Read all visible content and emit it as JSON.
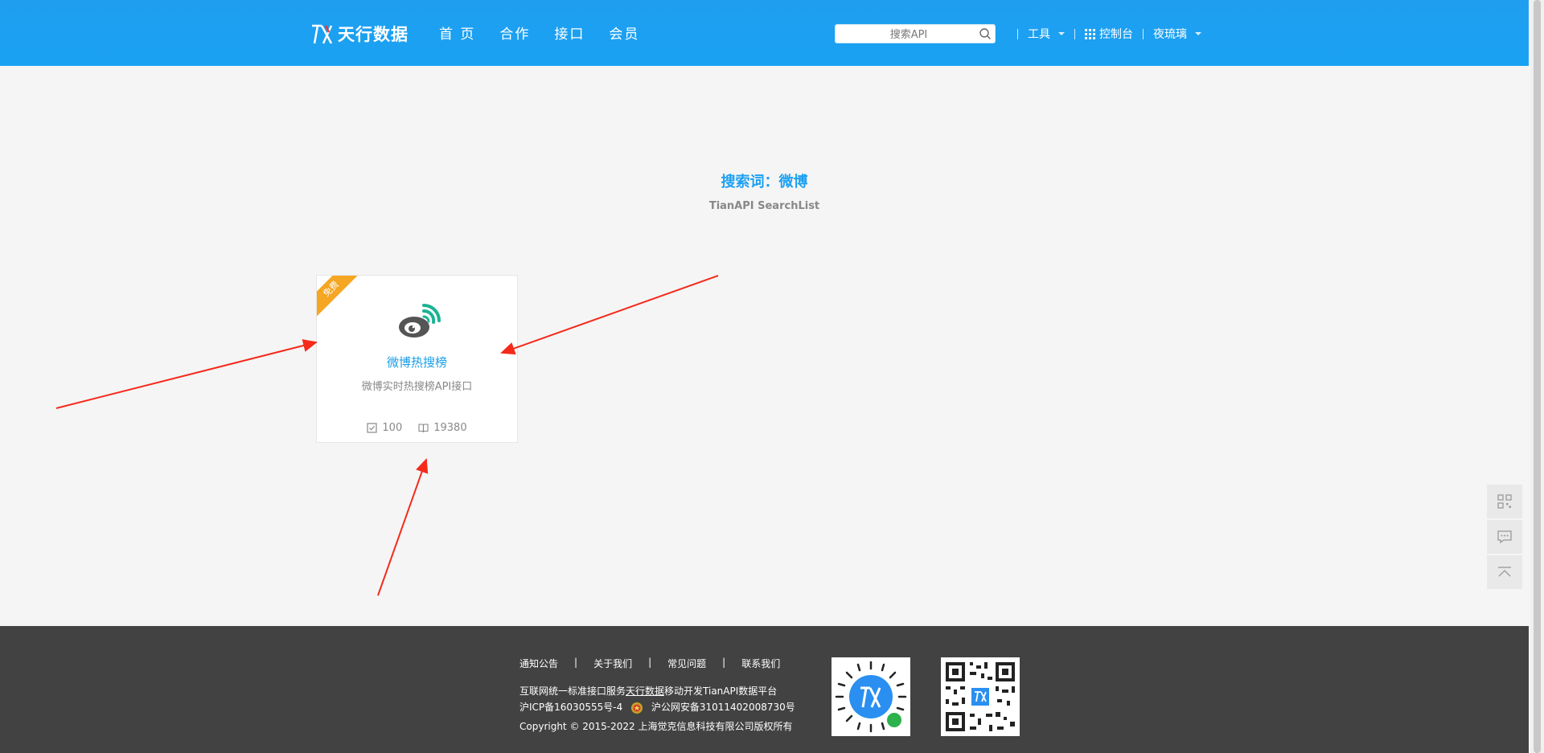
{
  "header": {
    "logo_text": "天行数据",
    "nav": [
      "首 页",
      "合作",
      "接口",
      "会员"
    ],
    "search_placeholder": "搜索API",
    "tools_label": "工具",
    "console_label": "控制台",
    "user_label": "夜琉璃"
  },
  "search_result": {
    "title": "搜索词：微博",
    "subtitle": "TianAPI SearchList"
  },
  "card": {
    "ribbon": "免费",
    "name": "微博热搜榜",
    "description": "微博实时热搜榜API接口",
    "stat_checks": "100",
    "stat_reads": "19380",
    "accent": "#1a9de6",
    "ribbon_color": "#f5a623"
  },
  "footer": {
    "links": [
      "通知公告",
      "关于我们",
      "常见问题",
      "联系我们"
    ],
    "separator": "|",
    "line1_prefix": "互联网统一标准接口服务",
    "line1_link": "天行数据",
    "line1_suffix": "移动开发TianAPI数据平台",
    "icp": "沪ICP备16030555号-4",
    "police": "沪公网安备31011402008730号",
    "copyright": "Copyright © 2015-2022 上海觉克信息科技有限公司版权所有"
  },
  "icons": {
    "search": "search-icon",
    "grid": "grid-icon",
    "weibo": "weibo-icon",
    "qr": "qrcode-icon",
    "chat": "chat-icon",
    "top": "back-to-top-icon"
  }
}
